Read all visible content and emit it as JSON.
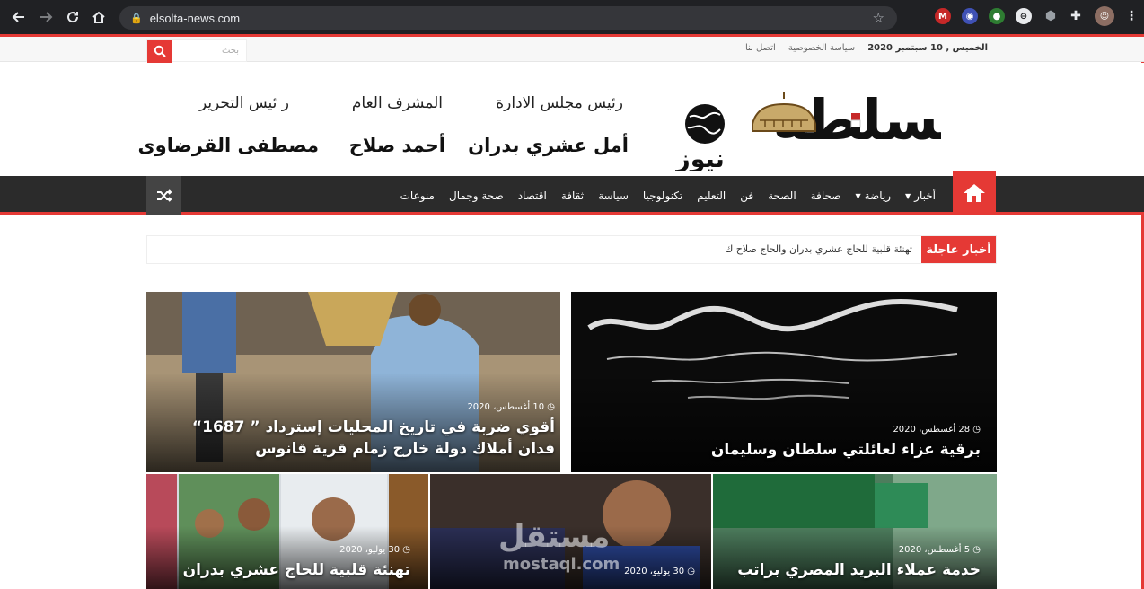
{
  "browser": {
    "url": "elsolta-news.com",
    "icons": [
      "back-arrow",
      "forward-arrow",
      "reload",
      "home",
      "lock",
      "star",
      "extension-m",
      "extension-blue",
      "extension-green",
      "extension-circle",
      "shield",
      "puzzle",
      "avatar",
      "kebab-menu"
    ]
  },
  "topbar": {
    "date": "الخميس , 10 سبتمبر 2020",
    "links": [
      "سياسة الخصوصية",
      "اتصل بنا"
    ],
    "search_placeholder": "بحث"
  },
  "header": {
    "logo_text": "السلطة",
    "logo_sub": "نيوز",
    "staff": [
      {
        "role": "رئيس مجلس الادارة",
        "name": "أمل عشري بدران"
      },
      {
        "role": "المشرف العام",
        "name": "أحمد صلاح"
      },
      {
        "role": "ر ئيس التحرير",
        "name": "مصطفى القرضاوى"
      }
    ]
  },
  "menu": {
    "items": [
      "أخبار",
      "رياضة",
      "صحافة",
      "الصحة",
      "فن",
      "التعليم",
      "تكنولوجيا",
      "سياسة",
      "ثقافة",
      "اقتصاد",
      "صحة وجمال",
      "منوعات"
    ]
  },
  "breaking": {
    "label": "أخبار عاجلة",
    "text": "تهنئة قلبية للحاج عشري بدران والحاج صلاح ك"
  },
  "posts": [
    {
      "date": "28 أغسطس، 2020",
      "title": "برقية عزاء لعائلتي سلطان وسليمان"
    },
    {
      "date": "10 أغسطس، 2020",
      "title": "أقوي ضربة في تاريخ المحليات إسترداد ” 1687“ فدان أملاك دولة خارج زمام قرية قانوس"
    },
    {
      "date": "5 أغسطس، 2020",
      "title": "خدمة عملاء البريد المصري براتب"
    },
    {
      "date": "30 يوليو، 2020",
      "title": ""
    },
    {
      "date": "30 يوليو، 2020",
      "title": "تهنئة قلبية للحاج عشري بدران"
    }
  ],
  "watermark": {
    "line1": "مستقل",
    "line2": "mostaql.com"
  },
  "colors": {
    "accent": "#e53935",
    "nav_bg": "#2b2b2b"
  }
}
